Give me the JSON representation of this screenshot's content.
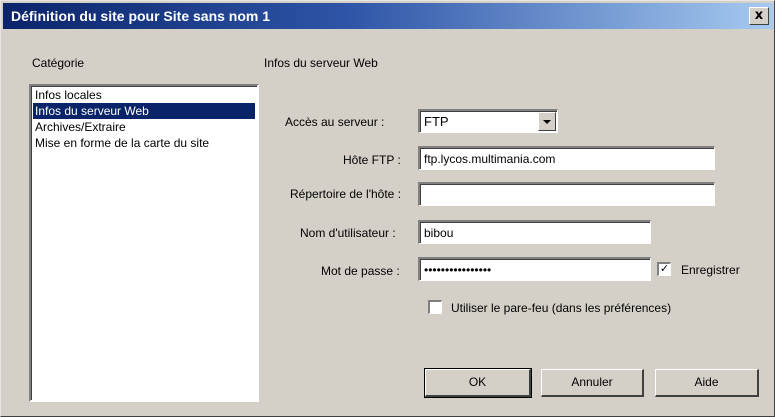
{
  "window": {
    "title": "Définition du site pour  Site sans nom 1",
    "close_glyph": "x"
  },
  "category": {
    "label": "Catégorie",
    "items": [
      {
        "label": "Infos locales",
        "selected": false
      },
      {
        "label": "Infos du serveur Web",
        "selected": true
      },
      {
        "label": "Archives/Extraire",
        "selected": false
      },
      {
        "label": "Mise en forme de la carte du site",
        "selected": false
      }
    ]
  },
  "panel": {
    "title": "Infos du serveur Web",
    "access": {
      "label": "Accès au serveur :",
      "value": "FTP"
    },
    "host": {
      "label": "Hôte FTP :",
      "value": "ftp.lycos.multimania.com"
    },
    "host_dir": {
      "label": "Répertoire de l'hôte :",
      "value": ""
    },
    "username": {
      "label": "Nom d'utilisateur :",
      "value": "bibou"
    },
    "password": {
      "label": "Mot de passe :",
      "value": "••••••••••••••••"
    },
    "save_checkbox": {
      "label": "Enregistrer",
      "checked": true
    },
    "firewall_checkbox": {
      "label": "Utiliser le pare-feu (dans les préférences)",
      "checked": false
    }
  },
  "buttons": {
    "ok": "OK",
    "cancel": "Annuler",
    "help": "Aide"
  }
}
